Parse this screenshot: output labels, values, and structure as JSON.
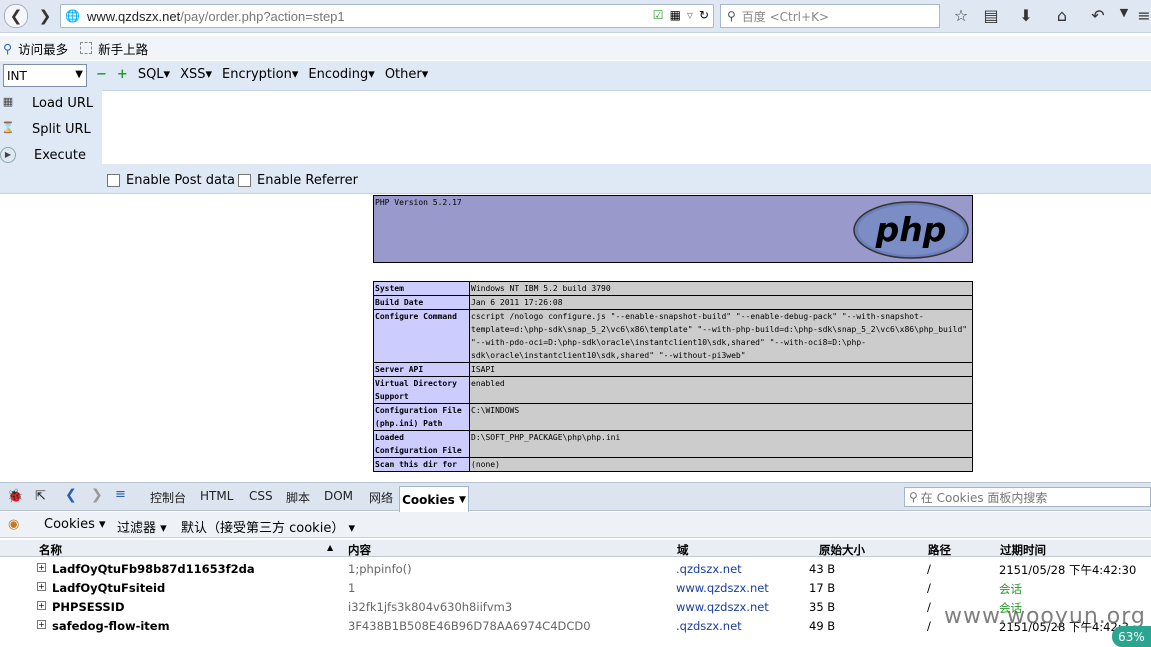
{
  "browser": {
    "url_host": "www.qzdszx.net",
    "url_path": "/pay/order.php?action=step1",
    "search_placeholder": "百度 <Ctrl+K>"
  },
  "bookmarks": [
    "访问最多",
    "新手上路"
  ],
  "hackbar": {
    "int_select": "INT",
    "menus": [
      "SQL",
      "XSS",
      "Encryption",
      "Encoding",
      "Other"
    ],
    "load_url": "Load URL",
    "split_url": "Split URL",
    "execute": "Execute",
    "url_value": "",
    "enable_post": "Enable Post data",
    "enable_referrer": "Enable Referrer"
  },
  "phpinfo": {
    "version": "PHP Version 5.2.17",
    "rows": [
      {
        "k": "System",
        "v": "Windows NT IBM 5.2 build 3790"
      },
      {
        "k": "Build Date",
        "v": "Jan 6 2011 17:26:08"
      },
      {
        "k": "Configure Command",
        "v": "cscript /nologo configure.js \"--enable-snapshot-build\" \"--enable-debug-pack\" \"--with-snapshot-template=d:\\php-sdk\\snap_5_2\\vc6\\x86\\template\" \"--with-php-build=d:\\php-sdk\\snap_5_2\\vc6\\x86\\php_build\" \"--with-pdo-oci=D:\\php-sdk\\oracle\\instantclient10\\sdk,shared\" \"--with-oci8=D:\\php-sdk\\oracle\\instantclient10\\sdk,shared\" \"--without-pi3web\""
      },
      {
        "k": "Server API",
        "v": "ISAPI"
      },
      {
        "k": "Virtual Directory Support",
        "v": "enabled"
      },
      {
        "k": "Configuration File (php.ini) Path",
        "v": "C:\\WINDOWS"
      },
      {
        "k": "Loaded Configuration File",
        "v": "D:\\SOFT_PHP_PACKAGE\\php\\php.ini"
      },
      {
        "k": "Scan this dir for",
        "v": "(none)"
      }
    ]
  },
  "firebug": {
    "tabs": [
      "控制台",
      "HTML",
      "CSS",
      "脚本",
      "DOM",
      "网络"
    ],
    "active_tab": "Cookies",
    "search_placeholder": "在 Cookies 面板内搜索",
    "sub_cookies": "Cookies",
    "sub_filter": "过滤器",
    "sub_default": "默认（接受第三方 cookie）",
    "headers": [
      "名称",
      "内容",
      "域",
      "原始大小",
      "路径",
      "过期时间"
    ],
    "cookies": [
      {
        "name": "LadfOyQtuFb98b87d11653f2da",
        "value": "1;phpinfo()",
        "domain": ".qzdszx.net",
        "size": "43 B",
        "path": "/",
        "expires": "2151/05/28 下午4:42:30",
        "session": false
      },
      {
        "name": "LadfOyQtuFsiteid",
        "value": "1",
        "domain": "www.qzdszx.net",
        "size": "17 B",
        "path": "/",
        "expires": "会话",
        "session": true
      },
      {
        "name": "PHPSESSID",
        "value": "i32fk1jfs3k804v630h8iifvm3",
        "domain": "www.qzdszx.net",
        "size": "35 B",
        "path": "/",
        "expires": "会话",
        "session": true
      },
      {
        "name": "safedog-flow-item",
        "value": "3F438B1B508E46B96D78AA6974C4DCD0",
        "domain": ".qzdszx.net",
        "size": "49 B",
        "path": "/",
        "expires": "2151/05/28 下午4:42:3",
        "session": false
      }
    ]
  },
  "watermark": "www.wooyun.org",
  "zoom": "63%"
}
